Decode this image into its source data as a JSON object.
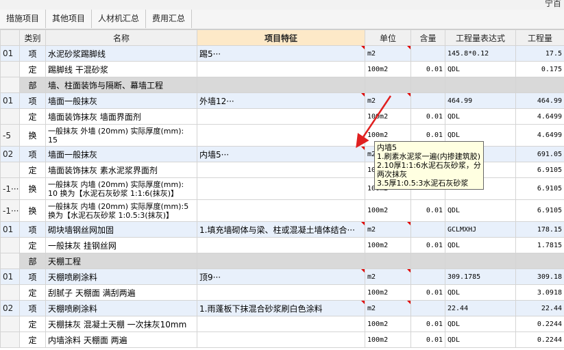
{
  "topstrip": {
    "right_text": "宁百"
  },
  "tabs": [
    {
      "label": "措施项目"
    },
    {
      "label": "其他项目"
    },
    {
      "label": "人材机汇总"
    },
    {
      "label": "费用汇总"
    }
  ],
  "columns": {
    "code": "",
    "type": "类别",
    "name": "名称",
    "feature": "项目特征",
    "unit": "单位",
    "content": "含量",
    "expr": "工程量表达式",
    "qty": "工程量"
  },
  "rows": [
    {
      "code": "01",
      "type": "项",
      "name": "水泥砂浆踢脚线",
      "feature": "踢5···",
      "unit": "m2",
      "content": "",
      "expr": "145.8*0.12",
      "qty": "17.5"
    },
    {
      "code": "",
      "type": "定",
      "name": "踢脚线 干混砂浆",
      "feature": "",
      "unit": "100m2",
      "content": "0.01",
      "expr": "QDL",
      "qty": "0.175"
    },
    {
      "code": "",
      "type": "部",
      "name": "墙、柱面装饰与隔断、幕墙工程",
      "feature": "",
      "unit": "",
      "content": "",
      "expr": "",
      "qty": ""
    },
    {
      "code": "01",
      "type": "项",
      "name": "墙面一般抹灰",
      "feature": "外墙12···",
      "unit": "m2",
      "content": "",
      "expr": "464.99",
      "qty": "464.99"
    },
    {
      "code": "",
      "type": "定",
      "name": "墙面装饰抹灰 墙面界面剂",
      "feature": "",
      "unit": "100m2",
      "content": "0.01",
      "expr": "QDL",
      "qty": "4.6499"
    },
    {
      "code": "-5",
      "type": "换",
      "name": "一般抹灰 外墙 (20mm) 实际厚度(mm): 15",
      "feature": "",
      "unit": "100m2",
      "content": "0.01",
      "expr": "QDL",
      "qty": "4.6499"
    },
    {
      "code": "02",
      "type": "项",
      "name": "墙面一般抹灰",
      "feature": "内墙5···",
      "unit": "m2",
      "content": "",
      "expr": "",
      "qty": "691.05"
    },
    {
      "code": "",
      "type": "定",
      "name": "墙面装饰抹灰 素水泥浆界面剂",
      "feature": "",
      "unit": "100m2",
      "content": "",
      "expr": "",
      "qty": "6.9105"
    },
    {
      "code": "-1···",
      "type": "换",
      "name": "一般抹灰 内墙 (20mm) 实际厚度(mm): 10 换为【水泥石灰砂浆 1:1:6(抹灰)】",
      "feature": "",
      "unit": "100m2",
      "content": "",
      "expr": "",
      "qty": "6.9105"
    },
    {
      "code": "-1···",
      "type": "换",
      "name": "一般抹灰 内墙 (20mm) 实际厚度(mm):5 换为【水泥石灰砂浆 1:0.5:3(抹灰)】",
      "feature": "",
      "unit": "100m2",
      "content": "0.01",
      "expr": "QDL",
      "qty": "6.9105"
    },
    {
      "code": "01",
      "type": "项",
      "name": "砌块墙钢丝网加固",
      "feature": "1.填充墙砌体与梁、柱或混凝土墙体结合···",
      "unit": "m2",
      "content": "",
      "expr": "GCLMXHJ",
      "qty": "178.15"
    },
    {
      "code": "",
      "type": "定",
      "name": "一般抹灰 挂钢丝网",
      "feature": "",
      "unit": "100m2",
      "content": "0.01",
      "expr": "QDL",
      "qty": "1.7815"
    },
    {
      "code": "",
      "type": "部",
      "name": "天棚工程",
      "feature": "",
      "unit": "",
      "content": "",
      "expr": "",
      "qty": ""
    },
    {
      "code": "01",
      "type": "项",
      "name": "天棚喷刷涂料",
      "feature": "顶9···",
      "unit": "m2",
      "content": "",
      "expr": "309.1785",
      "qty": "309.18"
    },
    {
      "code": "",
      "type": "定",
      "name": "刮腻子 天棚面 满刮两遍",
      "feature": "",
      "unit": "100m2",
      "content": "0.01",
      "expr": "QDL",
      "qty": "3.0918"
    },
    {
      "code": "02",
      "type": "项",
      "name": "天棚喷刷涂料",
      "feature": "1.雨蓬板下抹混合砂浆刷白色涂料",
      "unit": "m2",
      "content": "",
      "expr": "22.44",
      "qty": "22.44"
    },
    {
      "code": "",
      "type": "定",
      "name": "天棚抹灰 混凝土天棚 一次抹灰10mm",
      "feature": "",
      "unit": "100m2",
      "content": "0.01",
      "expr": "QDL",
      "qty": "0.2244"
    },
    {
      "code": "",
      "type": "定",
      "name": "内墙涂料 天棚面 两遍",
      "feature": "",
      "unit": "100m2",
      "content": "0.01",
      "expr": "QDL",
      "qty": "0.2244"
    }
  ],
  "tooltip": {
    "lines": [
      "内墙5",
      "1.刷素水泥浆一遍(内掺建筑胶)",
      "2.10厚1:1:6水泥石灰砂浆，分两次抹灰",
      "3.5厚1:0.5:3水泥石灰砂浆"
    ]
  },
  "colors": {
    "category_row": "#d9d9d9",
    "item_row": "#e8f0fb",
    "feature_header": "#fde9c8",
    "tooltip_bg": "#ffffe1",
    "arrow": "#e02020"
  }
}
